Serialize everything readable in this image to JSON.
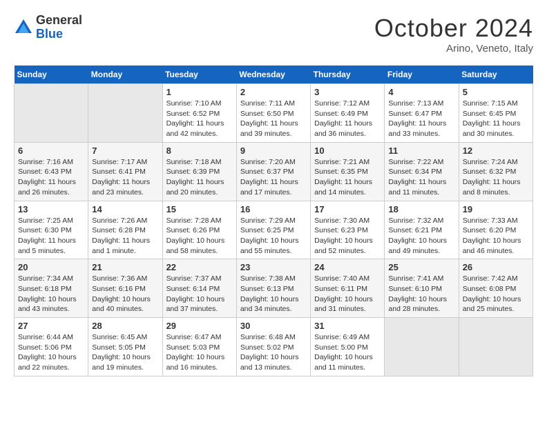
{
  "logo": {
    "general": "General",
    "blue": "Blue"
  },
  "header": {
    "month": "October 2024",
    "location": "Arino, Veneto, Italy"
  },
  "days_of_week": [
    "Sunday",
    "Monday",
    "Tuesday",
    "Wednesday",
    "Thursday",
    "Friday",
    "Saturday"
  ],
  "weeks": [
    [
      {
        "day": "",
        "info": ""
      },
      {
        "day": "",
        "info": ""
      },
      {
        "day": "1",
        "info": "Sunrise: 7:10 AM\nSunset: 6:52 PM\nDaylight: 11 hours and 42 minutes."
      },
      {
        "day": "2",
        "info": "Sunrise: 7:11 AM\nSunset: 6:50 PM\nDaylight: 11 hours and 39 minutes."
      },
      {
        "day": "3",
        "info": "Sunrise: 7:12 AM\nSunset: 6:49 PM\nDaylight: 11 hours and 36 minutes."
      },
      {
        "day": "4",
        "info": "Sunrise: 7:13 AM\nSunset: 6:47 PM\nDaylight: 11 hours and 33 minutes."
      },
      {
        "day": "5",
        "info": "Sunrise: 7:15 AM\nSunset: 6:45 PM\nDaylight: 11 hours and 30 minutes."
      }
    ],
    [
      {
        "day": "6",
        "info": "Sunrise: 7:16 AM\nSunset: 6:43 PM\nDaylight: 11 hours and 26 minutes."
      },
      {
        "day": "7",
        "info": "Sunrise: 7:17 AM\nSunset: 6:41 PM\nDaylight: 11 hours and 23 minutes."
      },
      {
        "day": "8",
        "info": "Sunrise: 7:18 AM\nSunset: 6:39 PM\nDaylight: 11 hours and 20 minutes."
      },
      {
        "day": "9",
        "info": "Sunrise: 7:20 AM\nSunset: 6:37 PM\nDaylight: 11 hours and 17 minutes."
      },
      {
        "day": "10",
        "info": "Sunrise: 7:21 AM\nSunset: 6:35 PM\nDaylight: 11 hours and 14 minutes."
      },
      {
        "day": "11",
        "info": "Sunrise: 7:22 AM\nSunset: 6:34 PM\nDaylight: 11 hours and 11 minutes."
      },
      {
        "day": "12",
        "info": "Sunrise: 7:24 AM\nSunset: 6:32 PM\nDaylight: 11 hours and 8 minutes."
      }
    ],
    [
      {
        "day": "13",
        "info": "Sunrise: 7:25 AM\nSunset: 6:30 PM\nDaylight: 11 hours and 5 minutes."
      },
      {
        "day": "14",
        "info": "Sunrise: 7:26 AM\nSunset: 6:28 PM\nDaylight: 11 hours and 1 minute."
      },
      {
        "day": "15",
        "info": "Sunrise: 7:28 AM\nSunset: 6:26 PM\nDaylight: 10 hours and 58 minutes."
      },
      {
        "day": "16",
        "info": "Sunrise: 7:29 AM\nSunset: 6:25 PM\nDaylight: 10 hours and 55 minutes."
      },
      {
        "day": "17",
        "info": "Sunrise: 7:30 AM\nSunset: 6:23 PM\nDaylight: 10 hours and 52 minutes."
      },
      {
        "day": "18",
        "info": "Sunrise: 7:32 AM\nSunset: 6:21 PM\nDaylight: 10 hours and 49 minutes."
      },
      {
        "day": "19",
        "info": "Sunrise: 7:33 AM\nSunset: 6:20 PM\nDaylight: 10 hours and 46 minutes."
      }
    ],
    [
      {
        "day": "20",
        "info": "Sunrise: 7:34 AM\nSunset: 6:18 PM\nDaylight: 10 hours and 43 minutes."
      },
      {
        "day": "21",
        "info": "Sunrise: 7:36 AM\nSunset: 6:16 PM\nDaylight: 10 hours and 40 minutes."
      },
      {
        "day": "22",
        "info": "Sunrise: 7:37 AM\nSunset: 6:14 PM\nDaylight: 10 hours and 37 minutes."
      },
      {
        "day": "23",
        "info": "Sunrise: 7:38 AM\nSunset: 6:13 PM\nDaylight: 10 hours and 34 minutes."
      },
      {
        "day": "24",
        "info": "Sunrise: 7:40 AM\nSunset: 6:11 PM\nDaylight: 10 hours and 31 minutes."
      },
      {
        "day": "25",
        "info": "Sunrise: 7:41 AM\nSunset: 6:10 PM\nDaylight: 10 hours and 28 minutes."
      },
      {
        "day": "26",
        "info": "Sunrise: 7:42 AM\nSunset: 6:08 PM\nDaylight: 10 hours and 25 minutes."
      }
    ],
    [
      {
        "day": "27",
        "info": "Sunrise: 6:44 AM\nSunset: 5:06 PM\nDaylight: 10 hours and 22 minutes."
      },
      {
        "day": "28",
        "info": "Sunrise: 6:45 AM\nSunset: 5:05 PM\nDaylight: 10 hours and 19 minutes."
      },
      {
        "day": "29",
        "info": "Sunrise: 6:47 AM\nSunset: 5:03 PM\nDaylight: 10 hours and 16 minutes."
      },
      {
        "day": "30",
        "info": "Sunrise: 6:48 AM\nSunset: 5:02 PM\nDaylight: 10 hours and 13 minutes."
      },
      {
        "day": "31",
        "info": "Sunrise: 6:49 AM\nSunset: 5:00 PM\nDaylight: 10 hours and 11 minutes."
      },
      {
        "day": "",
        "info": ""
      },
      {
        "day": "",
        "info": ""
      }
    ]
  ]
}
